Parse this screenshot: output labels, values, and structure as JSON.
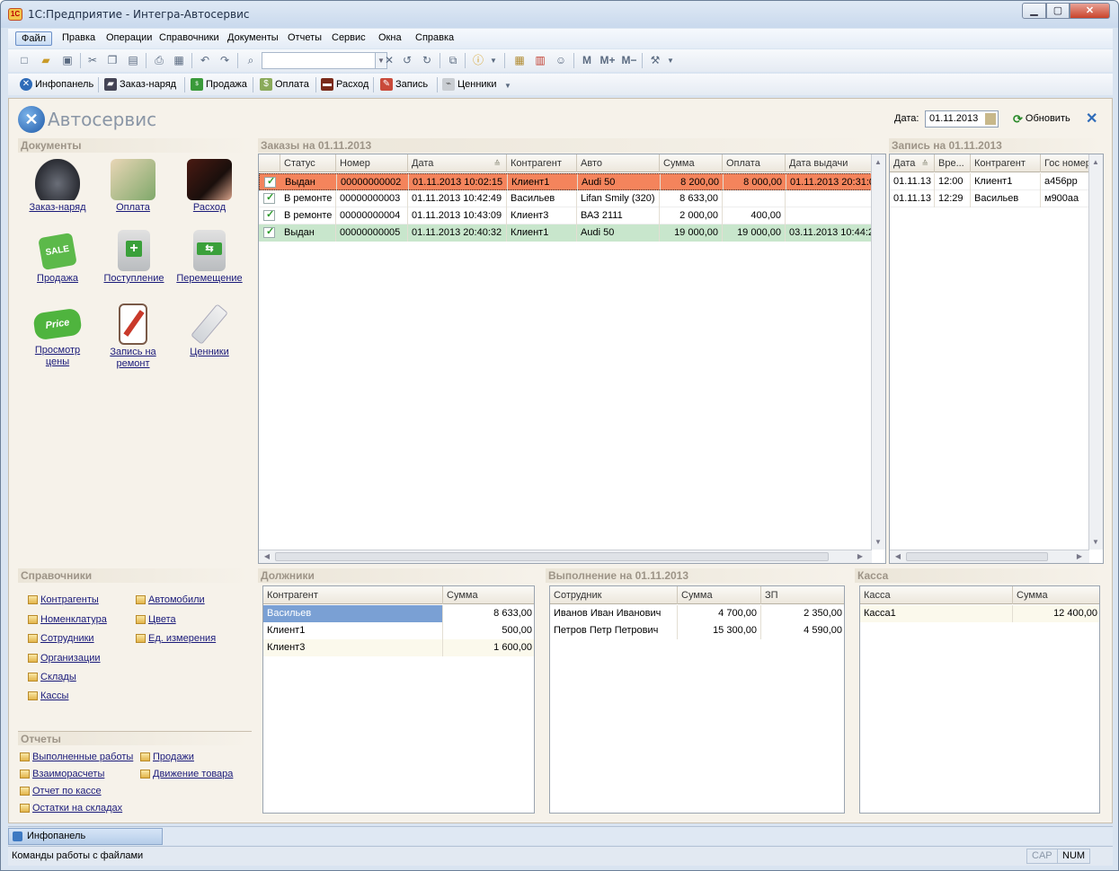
{
  "window": {
    "title": "1С:Предприятие - Интегра-Автосервис",
    "app_icon": "1С"
  },
  "menu": [
    "Файл",
    "Правка",
    "Операции",
    "Справочники",
    "Документы",
    "Отчеты",
    "Сервис",
    "Окна",
    "Справка"
  ],
  "toolbar2": {
    "items": [
      "Инфопанель",
      "Заказ-наряд",
      "Продажа",
      "Оплата",
      "Расход",
      "Запись",
      "Ценники"
    ]
  },
  "header": {
    "brand": "Автосервис",
    "date_label": "Дата:",
    "date_value": "01.11.2013",
    "refresh_label": "Обновить"
  },
  "documents": {
    "title": "Документы",
    "buttons": [
      {
        "label": "Заказ-наряд"
      },
      {
        "label": "Оплата"
      },
      {
        "label": "Расход"
      },
      {
        "label": "Продажа"
      },
      {
        "label": "Поступление"
      },
      {
        "label": "Перемещение"
      },
      {
        "label_line1": "Просмотр",
        "label_line2": "цены"
      },
      {
        "label_line1": "Запись на",
        "label_line2": "ремонт"
      },
      {
        "label": "Ценники"
      }
    ]
  },
  "references": {
    "title": "Справочники",
    "left": [
      "Контрагенты",
      "Номенклатура",
      "Сотрудники",
      "Организации",
      "Склады",
      "Кассы"
    ],
    "right": [
      "Автомобили",
      "Цвета",
      "Ед. измерения"
    ]
  },
  "reports": {
    "title": "Отчеты",
    "left": [
      "Выполненные работы",
      "Взаиморасчеты",
      "Отчет по кассе",
      "Остатки на складах"
    ],
    "right": [
      "Продажи",
      "Движение товара"
    ]
  },
  "orders": {
    "title": "Заказы на 01.11.2013",
    "columns": [
      "Статус",
      "Номер",
      "Дата",
      "Контрагент",
      "Авто",
      "Сумма",
      "Оплата",
      "Дата выдачи"
    ],
    "rows": [
      {
        "status": "Выдан",
        "number": "00000000002",
        "date": "01.11.2013 10:02:15",
        "client": "Клиент1",
        "car": "Audi 50",
        "sum": "8 200,00",
        "paid": "8 000,00",
        "issued": "01.11.2013 20:31:0"
      },
      {
        "status": "В ремонте",
        "number": "00000000003",
        "date": "01.11.2013 10:42:49",
        "client": "Васильев",
        "car": "Lifan Smily (320)",
        "sum": "8 633,00",
        "paid": "",
        "issued": ""
      },
      {
        "status": "В ремонте",
        "number": "00000000004",
        "date": "01.11.2013 10:43:09",
        "client": "Клиент3",
        "car": "ВАЗ 2111",
        "sum": "2 000,00",
        "paid": "400,00",
        "issued": ""
      },
      {
        "status": "Выдан",
        "number": "00000000005",
        "date": "01.11.2013 20:40:32",
        "client": "Клиент1",
        "car": "Audi 50",
        "sum": "19 000,00",
        "paid": "19 000,00",
        "issued": "03.11.2013 10:44:2"
      }
    ]
  },
  "appointments": {
    "title": "Запись на 01.11.2013",
    "columns": [
      "Дата",
      "Вре...",
      "Контрагент",
      "Гос номер"
    ],
    "rows": [
      {
        "date": "01.11.13",
        "time": "12:00",
        "client": "Клиент1",
        "plate": "а456рр"
      },
      {
        "date": "01.11.13",
        "time": "12:29",
        "client": "Васильев",
        "plate": "м900аа"
      }
    ]
  },
  "debtors": {
    "title": "Должники",
    "columns": [
      "Контрагент",
      "Сумма"
    ],
    "rows": [
      {
        "client": "Васильев",
        "sum": "8 633,00"
      },
      {
        "client": "Клиент1",
        "sum": "500,00"
      },
      {
        "client": "Клиент3",
        "sum": "1 600,00"
      }
    ]
  },
  "performance": {
    "title": "Выполнение на 01.11.2013",
    "columns": [
      "Сотрудник",
      "Сумма",
      "ЗП"
    ],
    "rows": [
      {
        "employee": "Иванов Иван Иванович",
        "sum": "4 700,00",
        "salary": "2 350,00"
      },
      {
        "employee": "Петров Петр Петрович",
        "sum": "15 300,00",
        "salary": "4 590,00"
      }
    ]
  },
  "cash": {
    "title": "Касса",
    "columns": [
      "Касса",
      "Сумма"
    ],
    "rows": [
      {
        "name": "Касса1",
        "sum": "12 400,00"
      }
    ]
  },
  "taskbar": {
    "item": "Инфопанель"
  },
  "statusbar": {
    "text": "Команды работы с файлами",
    "cap": "CAP",
    "num": "NUM"
  },
  "colors": {
    "row_issued_late": "#f4845c",
    "row_issued_ok": "#c8e6cc",
    "selected": "#7aa0d4"
  }
}
